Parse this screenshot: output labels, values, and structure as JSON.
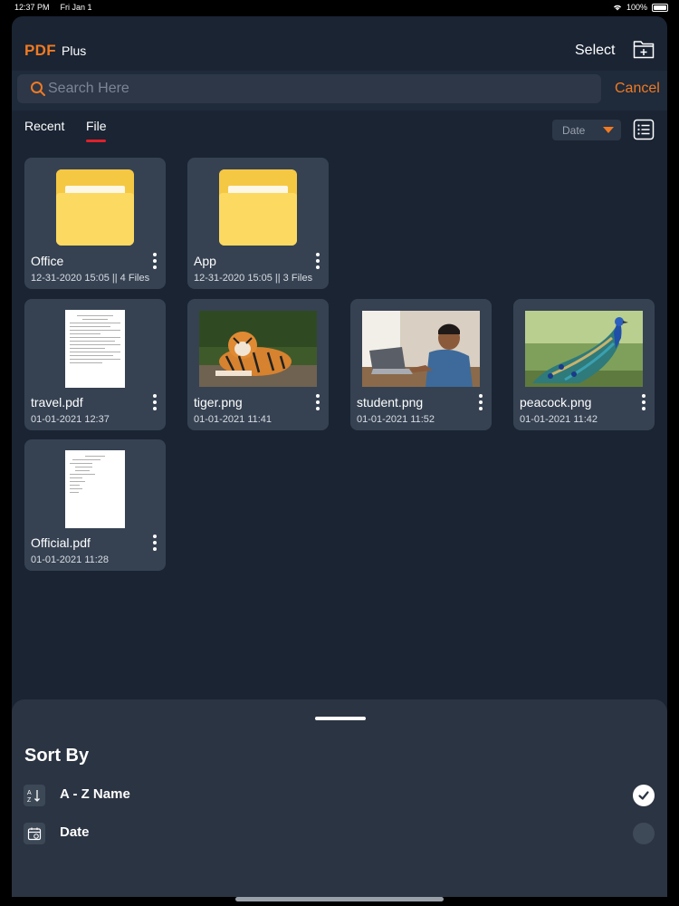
{
  "status_bar": {
    "time": "12:37 PM",
    "date": "Fri Jan 1",
    "battery": "100%"
  },
  "header": {
    "brand": "PDF",
    "brand_sub": "Plus",
    "select_label": "Select"
  },
  "search": {
    "placeholder": "Search Here",
    "cancel_label": "Cancel"
  },
  "tabs": [
    {
      "label": "Recent",
      "active": false
    },
    {
      "label": "File",
      "active": true
    }
  ],
  "sort_dropdown": {
    "value": "Date"
  },
  "items": [
    {
      "type": "folder",
      "name": "Office",
      "meta": "12-31-2020 15:05 || 4 Files"
    },
    {
      "type": "folder",
      "name": "App",
      "meta": "12-31-2020 15:05 || 3 Files"
    },
    {
      "type": "pdf",
      "name": "travel.pdf",
      "meta": "01-01-2021 12:37"
    },
    {
      "type": "image",
      "name": "tiger.png",
      "meta": "01-01-2021 11:41"
    },
    {
      "type": "image",
      "name": "student.png",
      "meta": "01-01-2021 11:52"
    },
    {
      "type": "image",
      "name": "peacock.png",
      "meta": "01-01-2021 11:42"
    },
    {
      "type": "pdf",
      "name": "Official.pdf",
      "meta": "01-01-2021 11:28"
    }
  ],
  "sort_sheet": {
    "title": "Sort By",
    "options": [
      {
        "label": "A - Z Name",
        "icon": "sort-az-icon",
        "selected": true
      },
      {
        "label": "Date",
        "icon": "calendar-icon",
        "selected": false
      }
    ]
  },
  "colors": {
    "accent": "#f07a22",
    "background": "#1a2433",
    "card": "#364252",
    "tab_indicator": "#e0202a"
  }
}
